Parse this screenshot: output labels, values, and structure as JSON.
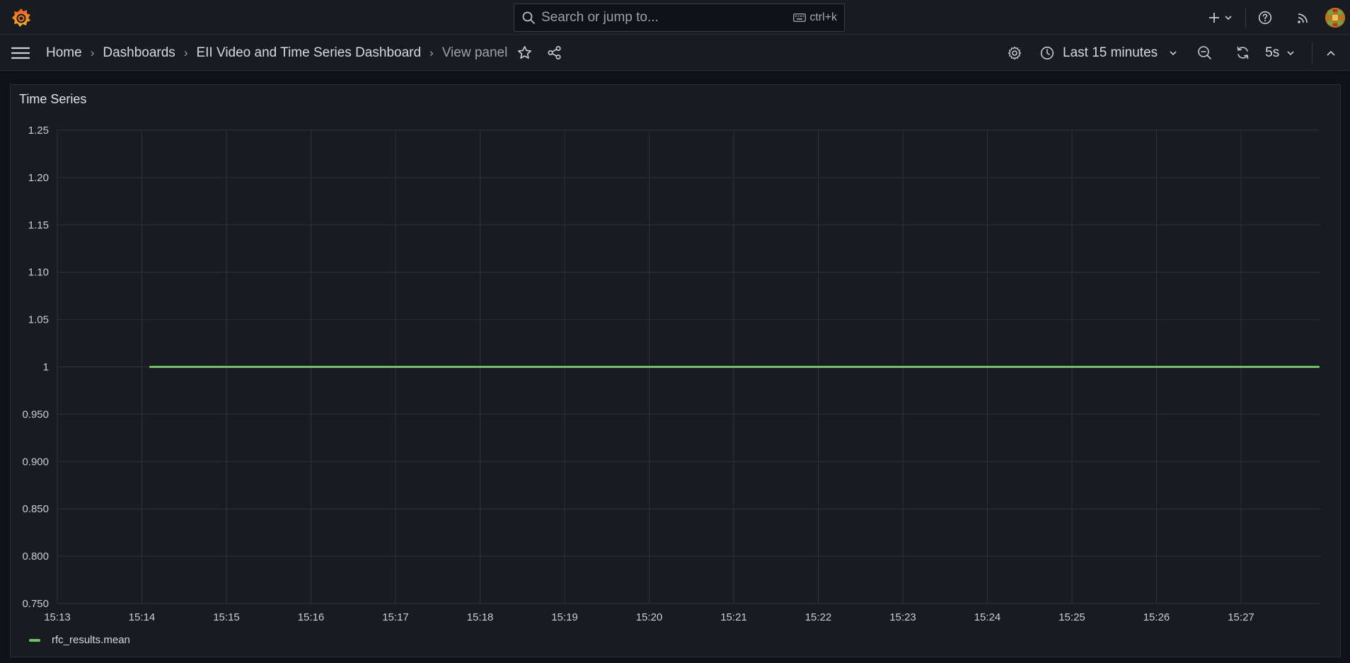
{
  "header": {
    "search_placeholder": "Search or jump to...",
    "shortcut": "ctrl+k",
    "icons": [
      "grafana-logo-icon",
      "search-icon",
      "keyboard-icon",
      "plus-icon",
      "chevron-down-icon",
      "help-icon",
      "rss-icon",
      "avatar"
    ]
  },
  "nav": {
    "breadcrumbs": [
      "Home",
      "Dashboards",
      "EII Video and Time Series Dashboard",
      "View panel"
    ],
    "time_range": "Last 15 minutes",
    "refresh_interval": "5s"
  },
  "panel": {
    "title": "Time Series"
  },
  "colors": {
    "series": "#73bf69",
    "background": "#111217",
    "panel": "#181b1f"
  },
  "chart_data": {
    "type": "line",
    "title": "Time Series",
    "xlabel": "",
    "ylabel": "",
    "x_ticks": [
      "15:13",
      "15:14",
      "15:15",
      "15:16",
      "15:17",
      "15:18",
      "15:19",
      "15:20",
      "15:21",
      "15:22",
      "15:23",
      "15:24",
      "15:25",
      "15:26",
      "15:27"
    ],
    "y_ticks": [
      "1.25",
      "1.20",
      "1.15",
      "1.10",
      "1.05",
      "1",
      "0.950",
      "0.900",
      "0.850",
      "0.800",
      "0.750"
    ],
    "y_tick_values": [
      1.25,
      1.2,
      1.15,
      1.1,
      1.05,
      1.0,
      0.95,
      0.9,
      0.85,
      0.8,
      0.75
    ],
    "ylim": [
      0.75,
      1.25
    ],
    "grid": true,
    "legend_position": "bottom-left",
    "series": [
      {
        "name": "rfc_results.mean",
        "color": "#73bf69",
        "x": [
          "15:14:06",
          "15:27:55"
        ],
        "y": [
          1,
          1
        ]
      }
    ]
  }
}
